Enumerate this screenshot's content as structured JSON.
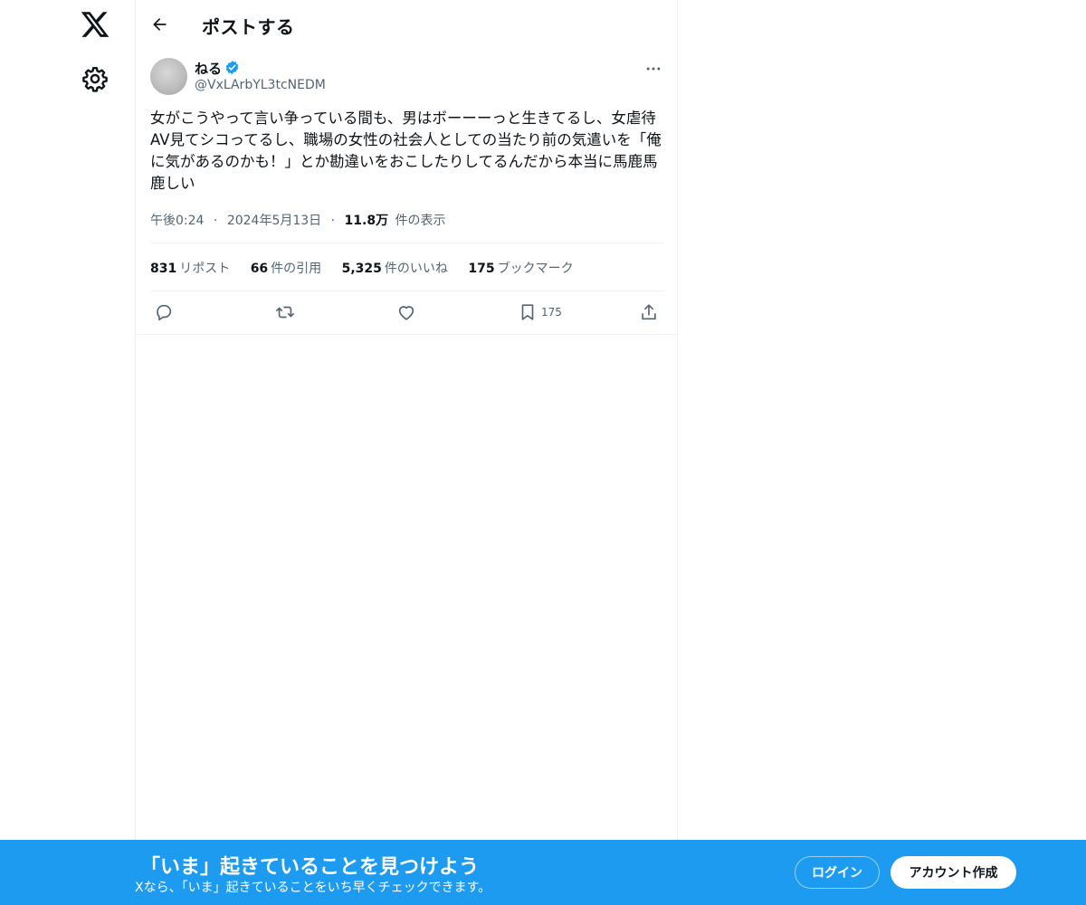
{
  "nav": {
    "logo_icon": "x-logo-icon",
    "settings_icon": "gear-icon"
  },
  "header": {
    "back_icon": "arrow-left-icon",
    "title": "ポストする"
  },
  "post": {
    "author": {
      "display_name": "ねる",
      "handle": "@VxLArbYL3tcNEDM",
      "verified_icon": "verified-badge-icon",
      "verified_color": "#1d9bf0"
    },
    "text": "女がこうやって言い争っている間も、男はボーーーっと生きてるし、女虐待AV見てシコってるし、職場の女性の社会人としての当たり前の気遣いを「俺に気があるのかも！」とか勘違いをおこしたりしてるんだから本当に馬鹿馬鹿しい",
    "time": "午後0:24",
    "date": "2024年5月13日",
    "views_count": "11.8万",
    "views_label": "件の表示",
    "separator": "·",
    "stats": {
      "reposts_count": "831",
      "reposts_label": "リポスト",
      "quotes_count": "66",
      "quotes_label": "件の引用",
      "likes_count": "5,325",
      "likes_label": "件のいいね",
      "bookmarks_count": "175",
      "bookmarks_label": "ブックマーク"
    },
    "actions": {
      "reply_icon": "reply-icon",
      "repost_icon": "repost-icon",
      "like_icon": "heart-icon",
      "bookmark_icon": "bookmark-icon",
      "bookmark_count": "175",
      "share_icon": "share-icon",
      "more_icon": "more-dots-icon"
    }
  },
  "banner": {
    "title": "「いま」起きていることを見つけよう",
    "subtitle": "Xなら、「いま」起きていることをいち早くチェックできます。",
    "login_label": "ログイン",
    "signup_label": "アカウント作成",
    "background_color": "#1d9bf0"
  }
}
